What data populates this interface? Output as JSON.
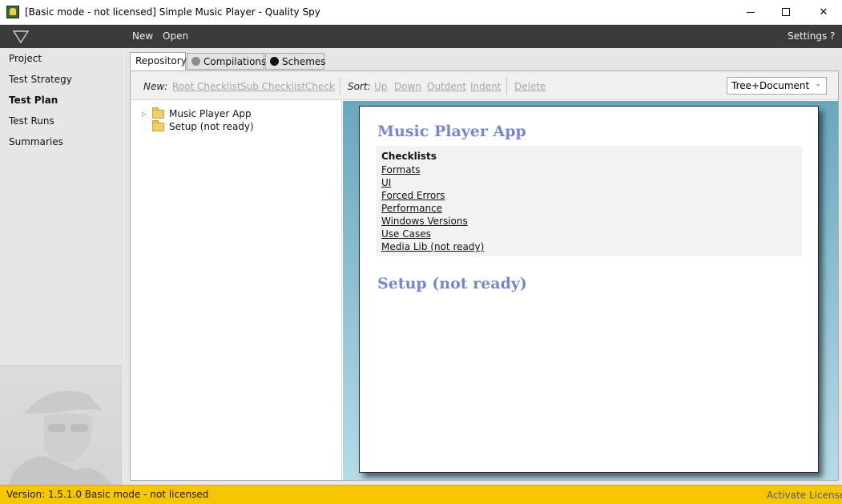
{
  "window": {
    "title": "[Basic mode - not licensed] Simple Music Player - Quality Spy"
  },
  "menubar": {
    "new_label": "New",
    "open_label": "Open",
    "settings_label": "Settings",
    "help_label": "?"
  },
  "sidebar": {
    "items": [
      {
        "label": "Project"
      },
      {
        "label": "Test Strategy"
      },
      {
        "label": "Test Plan"
      },
      {
        "label": "Test Runs"
      },
      {
        "label": "Summaries"
      }
    ],
    "active": "Test Plan"
  },
  "tabs": [
    {
      "label": "Repository"
    },
    {
      "label": "Compilations"
    },
    {
      "label": "Schemes"
    }
  ],
  "toolbar": {
    "new_label": "New:",
    "root_checklist": "Root Checklist",
    "sub_checklist": "Sub Checklist",
    "check": "Check",
    "sort_label": "Sort:",
    "up": "Up",
    "down": "Down",
    "outdent": "Outdent",
    "indent": "Indent",
    "delete": "Delete",
    "view_select": "Tree+Document"
  },
  "tree": {
    "items": [
      {
        "label": "Music Player App",
        "expandable": true
      },
      {
        "label": "Setup (not ready)",
        "expandable": false
      }
    ]
  },
  "document": {
    "heading1": "Music Player App",
    "checklists_title": "Checklists",
    "links": [
      "Formats",
      "UI",
      "Forced Errors",
      "Performance",
      "Windows Versions",
      "Use Cases",
      "Media Lib (not ready)"
    ],
    "heading2": "Setup (not ready)"
  },
  "statusbar": {
    "text": "Version: 1.5.1.0  Basic mode - not licensed",
    "activate_link": "Activate License"
  },
  "colors": {
    "menubar_bg": "#3b3b3b",
    "statusbar_bg": "#f7c600",
    "heading_color": "#7788c8",
    "link_blue": "#3d5fb3"
  }
}
